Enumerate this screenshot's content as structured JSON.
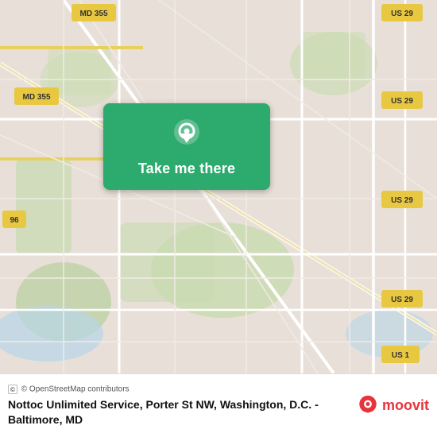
{
  "map": {
    "background_color": "#e8e0d8",
    "alt": "Map of Washington D.C. area"
  },
  "button": {
    "label": "Take me there",
    "background_color": "#2daa6e",
    "icon": "location-pin-icon"
  },
  "footer": {
    "osm_credit": "© OpenStreetMap contributors",
    "location_title": "Nottoc Unlimited Service, Porter St NW, Washington, D.C. - Baltimore, MD",
    "moovit_brand": "moovit"
  },
  "road_badges": [
    {
      "id": "md355-top-left",
      "label": "MD 355"
    },
    {
      "id": "md355-mid-left",
      "label": "MD 355"
    },
    {
      "id": "us29-top-right",
      "label": "US 29"
    },
    {
      "id": "us29-mid-right",
      "label": "US 29"
    },
    {
      "id": "us29-lower-right",
      "label": "US 29"
    },
    {
      "id": "us29-bottom-right",
      "label": "US 29"
    },
    {
      "id": "us1-bottom-right",
      "label": "US 1"
    },
    {
      "id": "i96-left",
      "label": "96"
    }
  ]
}
